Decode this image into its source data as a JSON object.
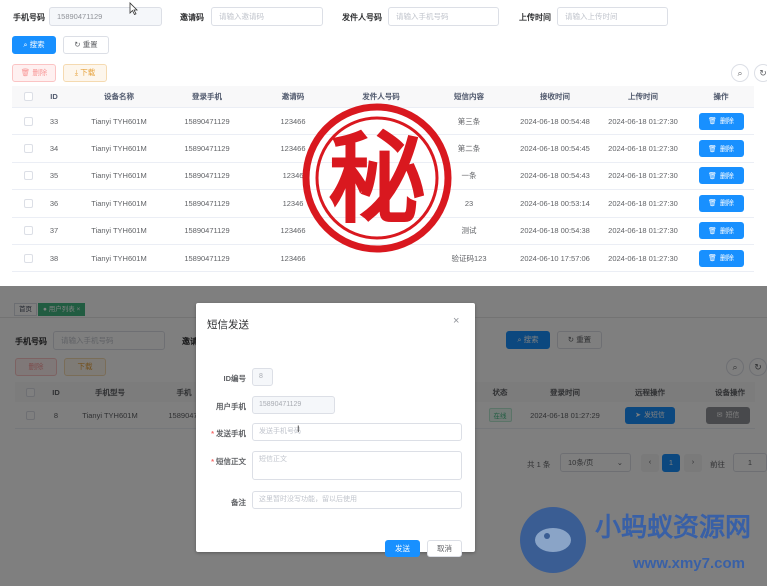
{
  "search_form": {
    "phone_label": "手机号码",
    "phone_value": "15890471129",
    "invite_label": "邀请码",
    "invite_placeholder": "请输入邀请码",
    "sender_label": "发件人号码",
    "sender_placeholder": "请输入手机号码",
    "upload_label": "上传时间",
    "upload_placeholder": "请输入上传时间",
    "search_btn": "搜索",
    "reset_btn": "重置"
  },
  "toolbar": {
    "delete_btn": "删除",
    "download_btn": "下载"
  },
  "sms_table": {
    "columns": [
      "ID",
      "设备名称",
      "登录手机",
      "邀请码",
      "发件人号码",
      "短信内容",
      "接收时间",
      "上传时间",
      "操作"
    ],
    "rows": [
      {
        "id": "33",
        "device": "Tianyi TYH601M",
        "phone": "15890471129",
        "invite": "123466",
        "sender": "",
        "content": "第三条",
        "received": "2024-06-18 00:54:48",
        "uploaded": "2024-06-18 01:27:30",
        "action": "删除"
      },
      {
        "id": "34",
        "device": "Tianyi TYH601M",
        "phone": "15890471129",
        "invite": "123466",
        "sender": "",
        "content": "第二条",
        "received": "2024-06-18 00:54:45",
        "uploaded": "2024-06-18 01:27:30",
        "action": "删除"
      },
      {
        "id": "35",
        "device": "Tianyi TYH601M",
        "phone": "15890471129",
        "invite": "12346",
        "sender": "",
        "content": "一条",
        "received": "2024-06-18 00:54:43",
        "uploaded": "2024-06-18 01:27:30",
        "action": "删除"
      },
      {
        "id": "36",
        "device": "Tianyi TYH601M",
        "phone": "15890471129",
        "invite": "12346",
        "sender": "",
        "content": "23",
        "received": "2024-06-18 00:53:14",
        "uploaded": "2024-06-18 01:27:30",
        "action": "删除"
      },
      {
        "id": "37",
        "device": "Tianyi TYH601M",
        "phone": "15890471129",
        "invite": "123466",
        "sender": "",
        "content": "测试",
        "received": "2024-06-18 00:54:38",
        "uploaded": "2024-06-18 01:27:30",
        "action": "删除"
      },
      {
        "id": "38",
        "device": "Tianyi TYH601M",
        "phone": "15890471129",
        "invite": "123466",
        "sender": "",
        "content": "验证码123",
        "received": "2024-06-10 17:57:06",
        "uploaded": "2024-06-18 01:27:30",
        "action": "删除"
      }
    ]
  },
  "seal": {
    "text": "秘"
  },
  "bottom_page": {
    "tags": {
      "home": "首页",
      "user_list": "用户列表"
    },
    "phone_label": "手机号码",
    "phone_placeholder": "请输入手机号码",
    "invite_label": "邀请码",
    "search_btn": "搜索",
    "reset_btn": "重置",
    "delete_btn": "删除",
    "download_btn": "下载",
    "columns": {
      "id": "ID",
      "model": "手机型号",
      "phone": "手机",
      "status": "状态",
      "login_time": "登录时间",
      "remote": "远程操作",
      "device_op": "设备操作"
    },
    "row": {
      "id": "8",
      "model": "Tianyi TYH601M",
      "phone": "1589047",
      "status": "在线",
      "login_time": "2024-06-18 01:27:29",
      "send_sms_btn": "发短信",
      "sms_btn": "短信"
    },
    "pagination": {
      "total": "共 1 条",
      "page_size": "10条/页",
      "current_page": "1",
      "goto_label": "前往",
      "goto_value": "1"
    }
  },
  "sms_dialog": {
    "title": "短信发送",
    "id_label": "ID编号",
    "id_value": "8",
    "user_phone_label": "用户手机",
    "user_phone_value": "15890471129",
    "send_phone_label": "发送手机",
    "send_phone_placeholder": "发送手机号码",
    "sms_body_label": "短信正文",
    "sms_body_placeholder": "短信正文",
    "remark_label": "备注",
    "remark_placeholder": "这里暂时没写功能，留以后使用",
    "send_btn": "发送",
    "cancel_btn": "取消"
  },
  "watermark": {
    "cn_text": "小蚂蚁资源网",
    "url": "www.xmy7.com"
  },
  "colors": {
    "primary": "#1890ff",
    "seal_red": "#d9181f",
    "success": "#42b983"
  }
}
